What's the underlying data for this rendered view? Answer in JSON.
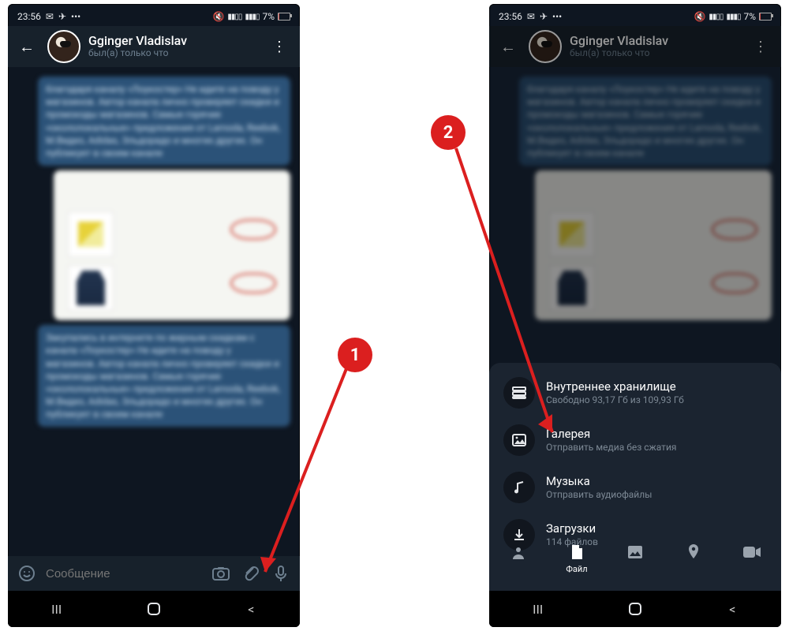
{
  "status": {
    "time": "23:56",
    "battery_pct": "7%"
  },
  "contact": {
    "name": "Gginger Vladislav",
    "status": "был(а) только что"
  },
  "input": {
    "placeholder": "Сообщение"
  },
  "attach": {
    "storage": {
      "title": "Внутреннее хранилище",
      "sub": "Свободно 93,17 Гб из 109,93 Гб"
    },
    "gallery": {
      "title": "Галерея",
      "sub": "Отправить медиа без сжатия"
    },
    "music": {
      "title": "Музыка",
      "sub": "Отправить аудиофайлы"
    },
    "downloads": {
      "title": "Загрузки",
      "sub": "114 файлов"
    },
    "tab_file": "Файл"
  },
  "annotations": {
    "one": "1",
    "two": "2"
  },
  "blur": {
    "t1": "благодаря каналу «Лоукостер»\nНе идите на поводу у магазинов. Автор\nканала лично проверяет скидки и\nпромокоды магазинов. Самые горячие\n«окололокальные» предложения от Lamoda,\nReebok, М.Видео, Adidas, Эльдорадо и\nмногих других.\nОн публикует в своем канале",
    "t2": "Закупались в интернете по жирным\nскидкам с канала «Лоукостер»\nНе идите на поводу у магазинов. Автор\nканала лично проверяет скидки и\nпромокоды магазинов. Самые горячие\n«окололокальные» предложения от Lamoda,\nReebok, М.Видео, Adidas, Эльдорадо и\nмногих других.\nОн публикует в своем канале"
  }
}
